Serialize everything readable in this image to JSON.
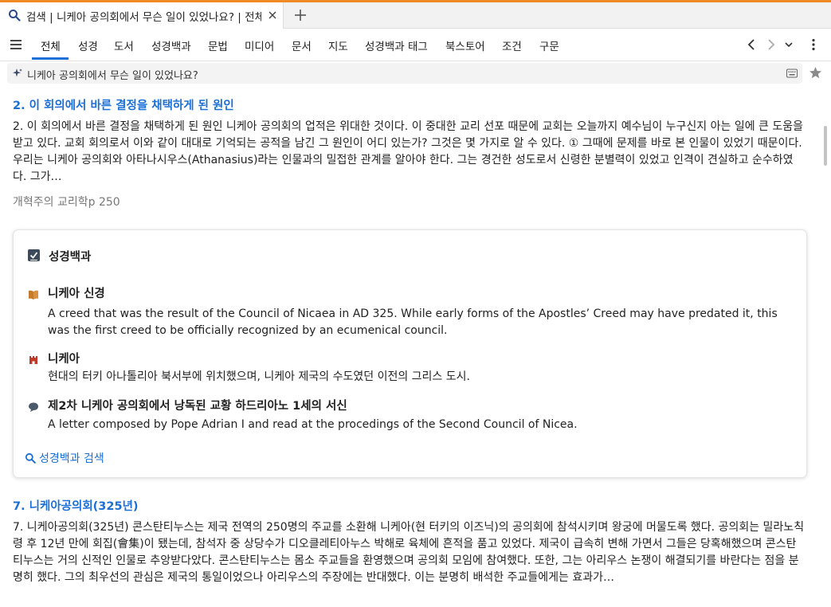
{
  "tab": {
    "title": "검색 | 니케아 공의회에서 무슨 일이 있었나요? | 전체",
    "icon": "search-icon"
  },
  "nav": {
    "tabs": [
      "전체",
      "성경",
      "도서",
      "성경백과",
      "문법",
      "미디어",
      "문서",
      "지도",
      "성경백과 태그",
      "북스토어",
      "조건",
      "구문"
    ],
    "active": "전체"
  },
  "search": {
    "query": "니케아 공의회에서 무슨 일이 있었나요?"
  },
  "results": [
    {
      "title": "2. 이 회의에서 바른 결정을 채택하게 된 원인",
      "body": "2. 이 회의에서 바른 결정을 채택하게 된 원인 니케아 공의회의 업적은 위대한 것이다. 이 중대한 교리 선포 때문에 교회는 오늘까지 예수님이 누구신지 아는 일에 큰 도움을 받고 있다. 교회 회의로서 이와 같이 대대로 기억되는 공적을 남긴 그 원인이 어디 있는가? 그것은 몇 가지로 알 수 있다. ① 그때에 문제를 바로 본 인물이 있었기 때문이다. 우리는 니케아 공의회와 아타나시우스(Athanasius)라는 인물과의 밀접한 관계를 알아야 한다. 그는 경건한 성도로서 신령한 분별력이 있었고 인격이 견실하고 순수하였다. 그가…",
      "source": "개혁주의 교리학p 250"
    },
    {
      "title": "7. 니케아공의회(325년)",
      "body": "7. 니케아공의회(325년) 콘스탄티누스는 제국 전역의 250명의 주교를 소환해 니케아(현 터키의 이즈닉)의 공의회에 참석시키며 왕궁에 머물도록 했다. 공의회는 밀라노칙령 후 12년 만에 회집(會集)이 됐는데, 참석자 중 상당수가 디오클레티아누스 박해로 육체에 흔적을 품고 있었다. 제국이 급속히 변해 가면서 그들은 당혹해했으며 콘스탄티누스는 거의 신적인 인물로 추앙받다았다. 콘스탄티누스는 몸소 주교들을 환영했으며 공의회 모임에 참여했다. 또한, 그는 아리우스 논쟁이 해결되기를 바란다는 점을 분명히 했다. 그의 최우선의 관심은 제국의 통일이었으나 아리우스의 주장에는 반대했다. 이는 분명히 배석한 주교들에게는 효과가…"
    }
  ],
  "factbook": {
    "heading": "성경백과",
    "entries": [
      {
        "title": "니케아 신경",
        "desc": "A creed that was the result of the Council of Nicaea in AD 325. While early forms of the Apostles’ Creed may have predated it, this was the first creed to be officially recognized by an ecumenical council.",
        "icon": "book-icon",
        "color": "#c77b2a"
      },
      {
        "title": "니케아",
        "desc": "현대의 터키 아나톨리아 북서부에 위치했으며, 니케아 제국의 수도였던 이전의 그리스 도시.",
        "icon": "castle-icon",
        "color": "#c0392b"
      },
      {
        "title": "제2차 니케아 공의회에서 낭독된 교황 하드리아노 1세의 서신",
        "desc": "A letter composed by Pope Adrian I and read at the procedings of the Second Council of Nicea.",
        "icon": "speech-bubble-icon",
        "color": "#4a5a6a"
      }
    ],
    "search_link": "성경백과 검색"
  },
  "colors": {
    "accent": "#1b6fd6",
    "top_bar": "#f08a24"
  }
}
